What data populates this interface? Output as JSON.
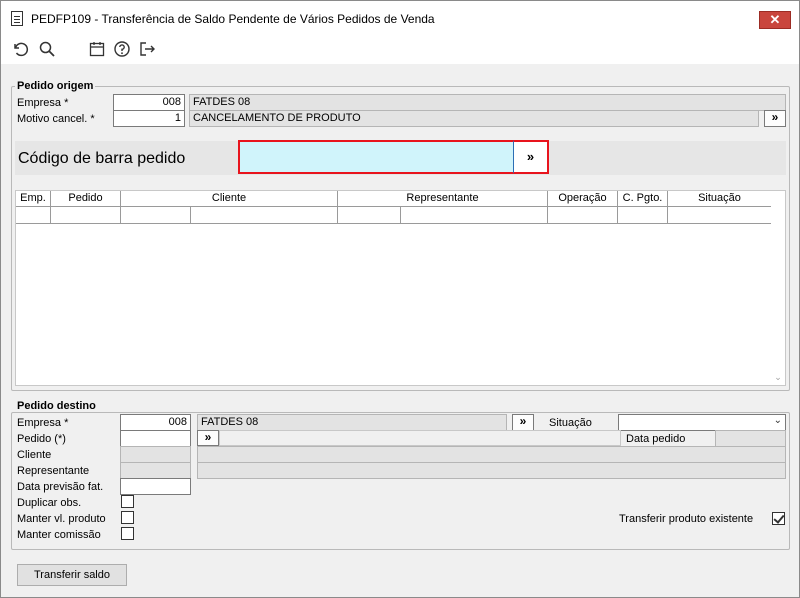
{
  "window": {
    "title": "PEDFP109 - Transferência de Saldo Pendente de Vários Pedidos de Venda",
    "close_label": "✕"
  },
  "toolbar": {
    "icons": [
      "undo-icon",
      "search-icon",
      "calendar-icon",
      "help-icon",
      "exit-icon"
    ]
  },
  "origem": {
    "legend": "Pedido origem",
    "empresa_label": "Empresa *",
    "empresa_code": "008",
    "empresa_name": "FATDES 08",
    "motivo_label": "Motivo cancel. *",
    "motivo_code": "1",
    "motivo_name": "CANCELAMENTO DE PRODUTO",
    "motivo_btn": "»"
  },
  "barcode": {
    "label": "Código de barra pedido",
    "value": "",
    "btn": "»"
  },
  "grid": {
    "columns": [
      "Emp.",
      "Pedido",
      "Cliente",
      "Representante",
      "Operação",
      "C. Pgto.",
      "Situação"
    ]
  },
  "destino": {
    "legend": "Pedido destino",
    "empresa_label": "Empresa *",
    "empresa_code": "008",
    "empresa_name": "FATDES 08",
    "empresa_btn": "»",
    "situacao_label": "Situação",
    "situacao_value": "",
    "pedido_label": "Pedido (*)",
    "pedido_btn": "»",
    "data_pedido_label": "Data pedido",
    "cliente_label": "Cliente",
    "representante_label": "Representante",
    "data_previsao_label": "Data previsão fat.",
    "duplicar_label": "Duplicar obs.",
    "duplicar_checked": false,
    "manter_vl_label": "Manter vl. produto",
    "manter_vl_checked": false,
    "manter_comissao_label": "Manter comissão",
    "manter_comissao_checked": false,
    "transferir_existente_label": "Transferir produto existente",
    "transferir_existente_checked": true
  },
  "actions": {
    "transferir_label": "Transferir saldo"
  }
}
